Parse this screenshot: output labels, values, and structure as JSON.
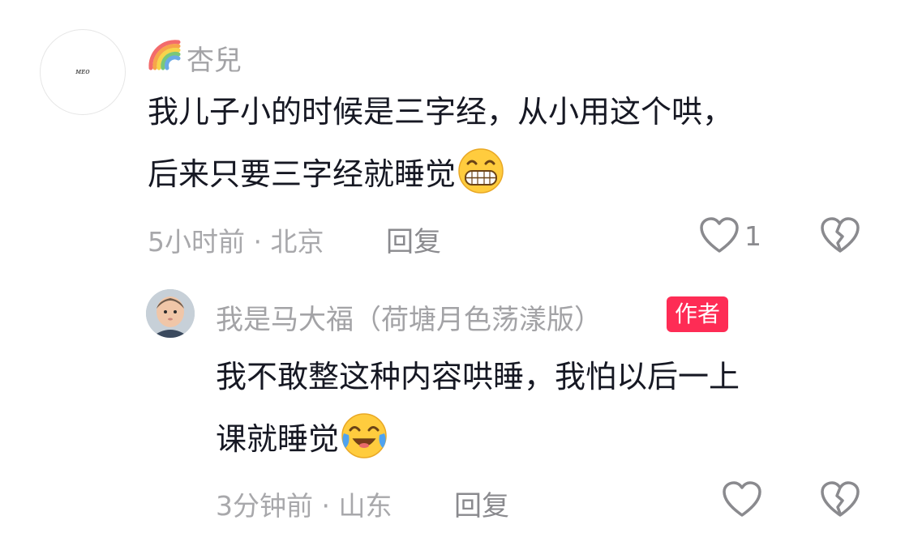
{
  "comment": {
    "username": "杏兒",
    "username_prefix_icon": "rainbow-emoji",
    "lines": [
      "我儿子小的时候是三字经，从小用这个哄，",
      "后来只要三字经就睡觉"
    ],
    "emoji": "grinning-emoji",
    "time_location": "5小时前 · 北京",
    "reply_label": "回复",
    "like_count": "1",
    "avatar_scribble": "ᴍᴇᴏ"
  },
  "reply": {
    "username": "我是马大福（荷塘月色荡漾版）",
    "author_badge": "作者",
    "lines": [
      "我不敢整这种内容哄睡，我怕以后一上",
      "课就睡觉"
    ],
    "emoji": "crying-laughing-emoji",
    "time_location": "3分钟前 · 山东",
    "reply_label": "回复",
    "like_count": ""
  },
  "colors": {
    "accent": "#fe2c55",
    "muted_text": "#a3a3a6",
    "primary_text": "#161823"
  }
}
